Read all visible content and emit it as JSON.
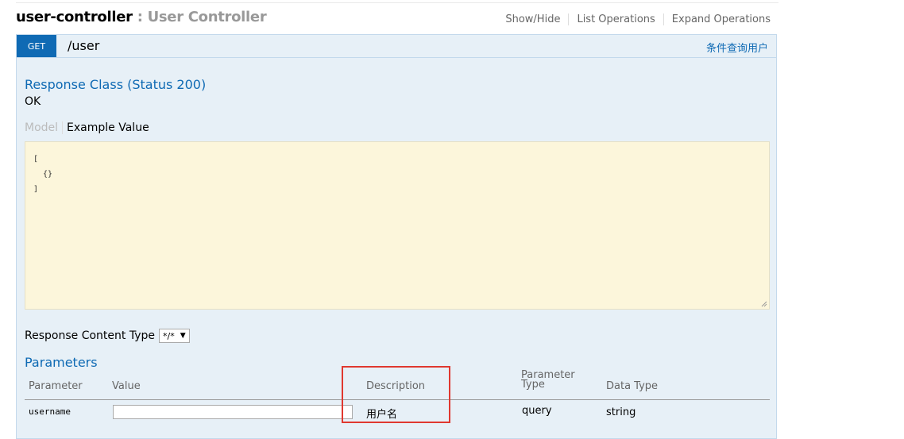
{
  "controller": {
    "name": "user-controller",
    "separator": ":",
    "description": "User Controller",
    "ops": {
      "show_hide": "Show/Hide",
      "list_operations": "List Operations",
      "expand_operations": "Expand Operations"
    }
  },
  "operation": {
    "method": "GET",
    "path": "/user",
    "summary": "条件查询用户",
    "response_class": {
      "title": "Response Class (Status 200)",
      "status_text": "OK"
    },
    "model_tabs": {
      "model": "Model",
      "example_value": "Example Value"
    },
    "example_value": "[\n  {}\n]",
    "response_content_type": {
      "label": "Response Content Type",
      "selected": "*/*"
    },
    "parameters": {
      "title": "Parameters",
      "headers": {
        "parameter": "Parameter",
        "value": "Value",
        "description": "Description",
        "parameter_type": "Parameter Type",
        "data_type": "Data Type"
      },
      "rows": [
        {
          "name": "username",
          "value": "",
          "description": "用户名",
          "parameter_type": "query",
          "data_type": "string"
        }
      ]
    }
  },
  "colors": {
    "get_method": "#0f6ab4",
    "panel_bg": "#e7f0f7",
    "example_bg": "#fcf6db",
    "highlight": "#e0382f"
  }
}
